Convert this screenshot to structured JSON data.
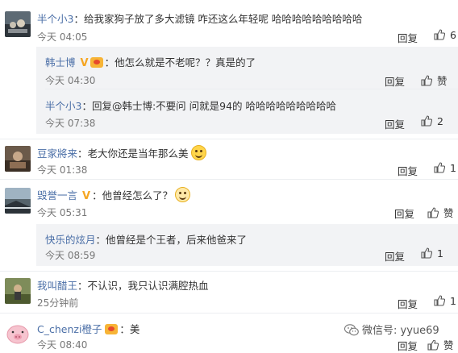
{
  "comments": [
    {
      "user": "半个小3",
      "text": "：给我家狗子放了多大滤镜  咋还这么年轻呢 哈哈哈哈哈哈哈哈哈",
      "time": "今天 04:05",
      "reply": "回复",
      "likes": "6",
      "replies": [
        {
          "user": "韩士博",
          "text": "：他怎么就是不老呢？？真是的了",
          "time": "今天 04:30",
          "reply": "回复",
          "likes": "赞"
        },
        {
          "user": "半个小3",
          "text": "：回复@韩士博:不要问 问就是94的 哈哈哈哈哈哈哈哈哈",
          "time": "今天 07:38",
          "reply": "回复",
          "likes": "2"
        }
      ]
    },
    {
      "user": "豆家將来",
      "text": "：老大你还是当年那么美",
      "time": "今天 01:38",
      "reply": "回复",
      "likes": "1",
      "replies": []
    },
    {
      "user": "毁誉一言",
      "text": "：他曾经怎么了？",
      "time": "今天 05:31",
      "reply": "回复",
      "likes": "赞",
      "replies": [
        {
          "user": "快乐的炫月",
          "text": "：他曾经是个王者，后来他爸来了",
          "time": "今天 08:59",
          "reply": "回复",
          "likes": "1"
        }
      ]
    },
    {
      "user": "我叫醋王",
      "text": "：不认识，我只认识满腔热血",
      "time": "25分钟前",
      "reply": "回复",
      "likes": "1",
      "replies": []
    },
    {
      "user": "C_chenzi橙子",
      "text": "：美",
      "time": "今天 08:40",
      "reply": "回复",
      "likes": "赞",
      "replies": []
    }
  ],
  "watermark": "微信号: yyue69",
  "colors": {
    "username": "#4b6fa7",
    "reply_bg": "#f2f3f5",
    "badge": "#f5a623"
  },
  "icons": {
    "like": "thumb-up-icon",
    "watermark": "wechat-icon"
  }
}
